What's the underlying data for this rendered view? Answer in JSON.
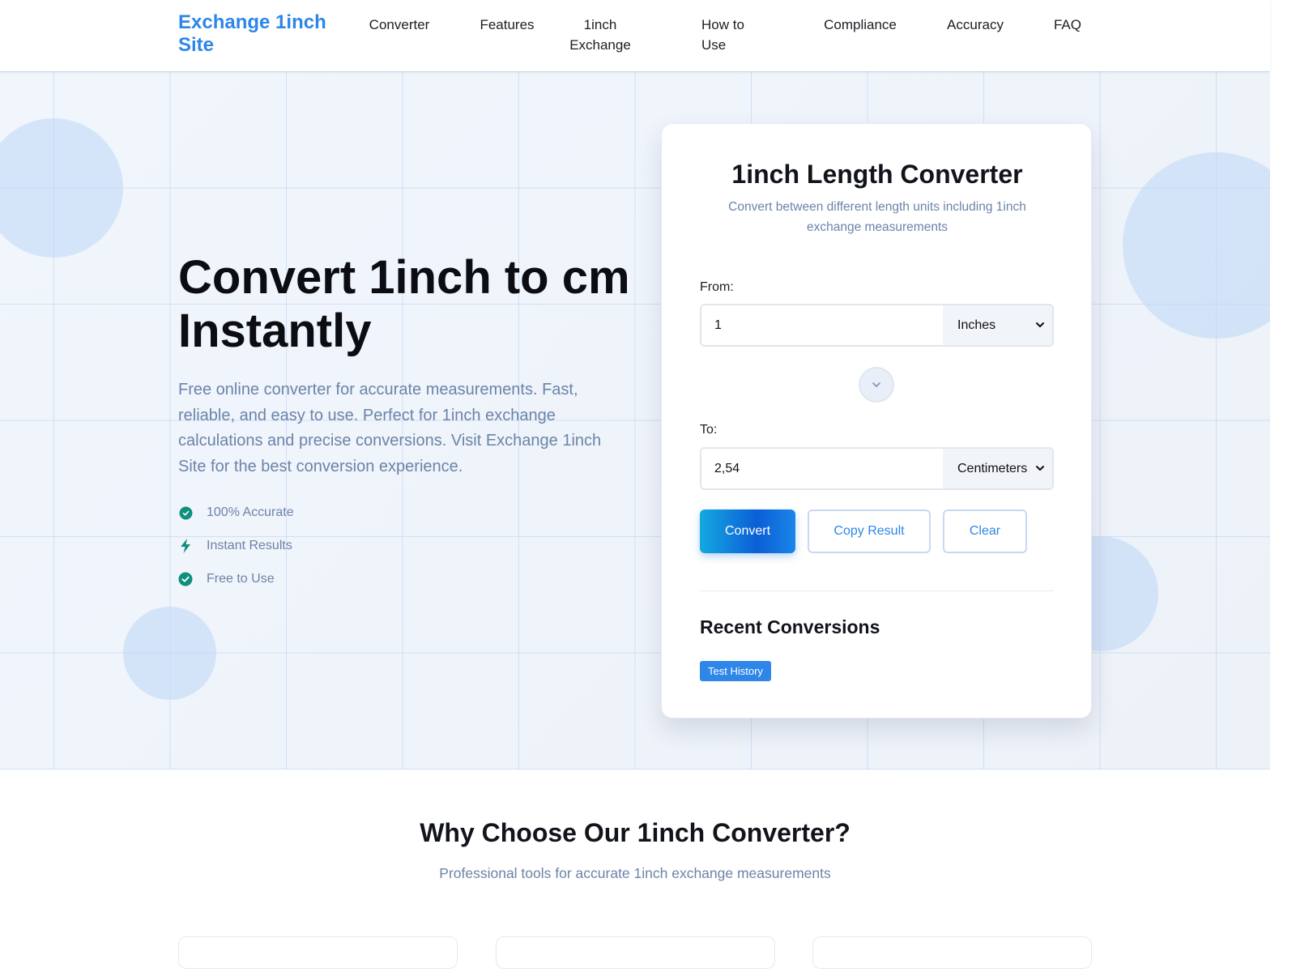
{
  "header": {
    "logo": "Exchange 1inch Site",
    "nav": [
      "Converter",
      "Features",
      "1inch Exchange",
      "How to Use",
      "Compliance",
      "Accuracy",
      "FAQ"
    ]
  },
  "hero": {
    "title": "Convert 1inch to cm Instantly",
    "description": "Free online converter for accurate measurements. Fast, reliable, and easy to use. Perfect for 1inch exchange calculations and precise conversions. Visit Exchange 1inch Site for the best conversion experience.",
    "features": [
      {
        "label": "100% Accurate",
        "icon": "check-badge-icon"
      },
      {
        "label": "Instant Results",
        "icon": "bolt-icon"
      },
      {
        "label": "Free to Use",
        "icon": "check-circle-icon"
      }
    ]
  },
  "converter": {
    "title": "1inch Length Converter",
    "subtitle": "Convert between different length units including 1inch exchange measurements",
    "from_label": "From:",
    "from_value": "1",
    "from_unit": "Inches",
    "to_label": "To:",
    "to_value": "2,54",
    "to_unit": "Centimeters",
    "convert_label": "Convert",
    "copy_label": "Copy Result",
    "clear_label": "Clear",
    "recent_title": "Recent Conversions",
    "history_chip": "Test History"
  },
  "why": {
    "title": "Why Choose Our 1inch Converter?",
    "subtitle": "Professional tools for accurate 1inch exchange measurements"
  },
  "colors": {
    "brand": "#2d86e8",
    "accent_teal": "#0f8f7e",
    "muted_text": "#6b84a8"
  }
}
